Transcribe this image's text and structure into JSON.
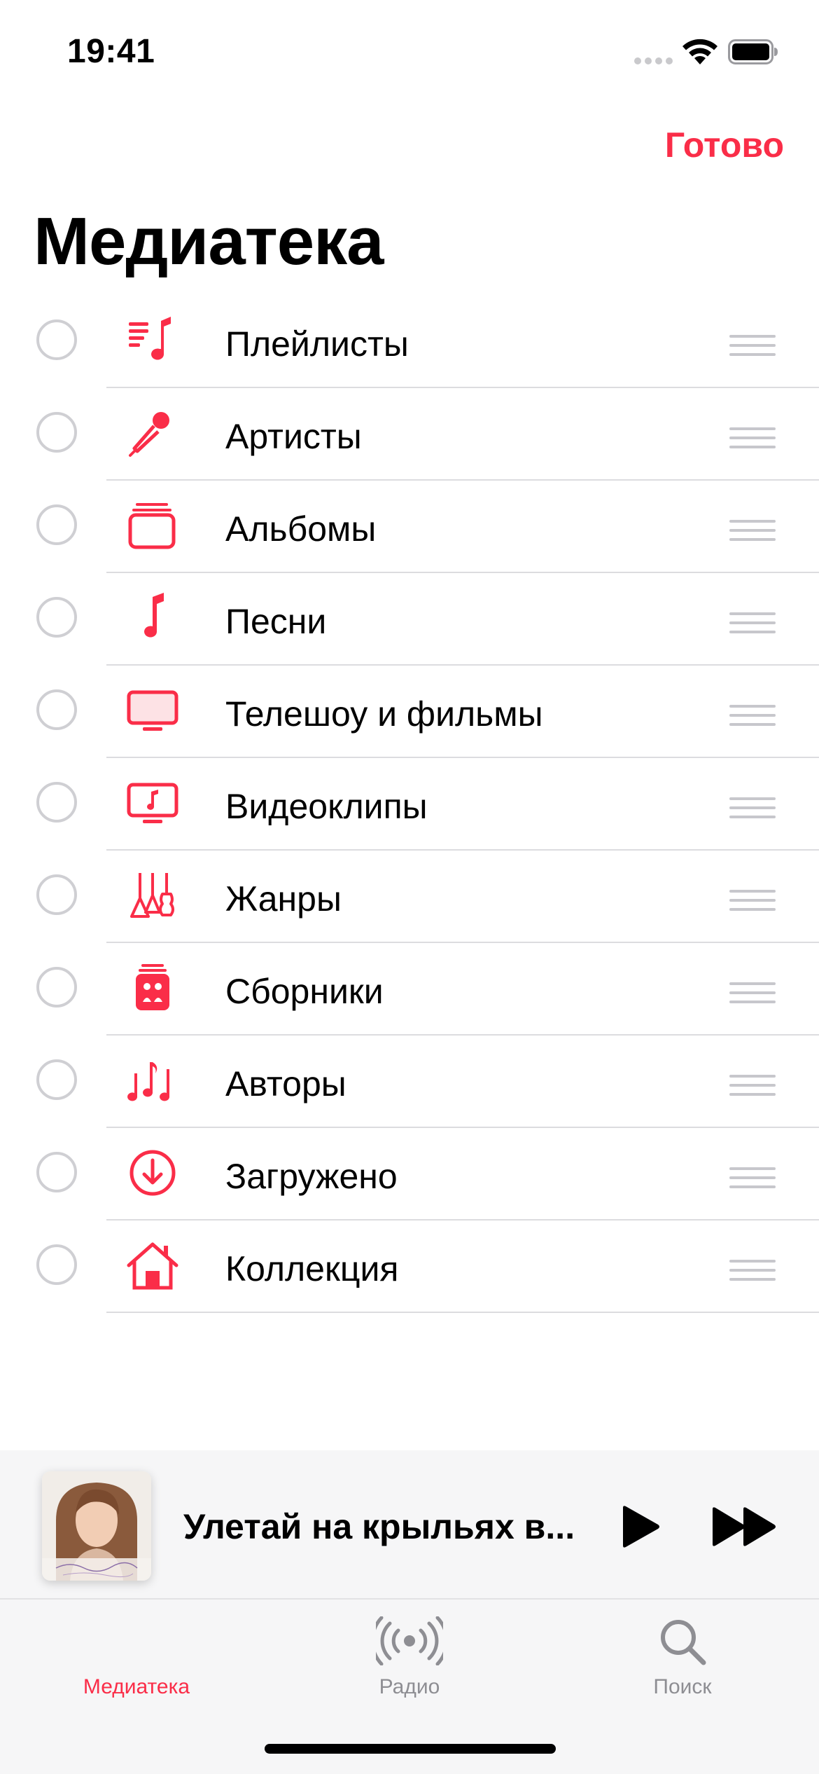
{
  "status_bar": {
    "time": "19:41"
  },
  "header": {
    "done_label": "Готово",
    "title": "Медиатека"
  },
  "library_items": [
    {
      "label": "Плейлисты",
      "icon": "playlist-icon"
    },
    {
      "label": "Артисты",
      "icon": "microphone-icon"
    },
    {
      "label": "Альбомы",
      "icon": "album-stack-icon"
    },
    {
      "label": "Песни",
      "icon": "music-note-icon"
    },
    {
      "label": "Телешоу и фильмы",
      "icon": "tv-icon"
    },
    {
      "label": "Видеоклипы",
      "icon": "music-video-icon"
    },
    {
      "label": "Жанры",
      "icon": "guitars-icon"
    },
    {
      "label": "Сборники",
      "icon": "compilation-icon"
    },
    {
      "label": "Авторы",
      "icon": "composer-notes-icon"
    },
    {
      "label": "Загружено",
      "icon": "download-icon"
    },
    {
      "label": "Коллекция",
      "icon": "home-icon"
    }
  ],
  "now_playing": {
    "title": "Улетай на крыльях в..."
  },
  "tab_bar": {
    "tabs": [
      {
        "label": "Медиатека",
        "icon": "library-icon",
        "active": true
      },
      {
        "label": "Радио",
        "icon": "radio-icon",
        "active": false
      },
      {
        "label": "Поиск",
        "icon": "search-icon",
        "active": false
      }
    ]
  },
  "colors": {
    "accent": "#fa2d48",
    "separator": "#dcdcdf",
    "inactive": "#8e8e93"
  }
}
